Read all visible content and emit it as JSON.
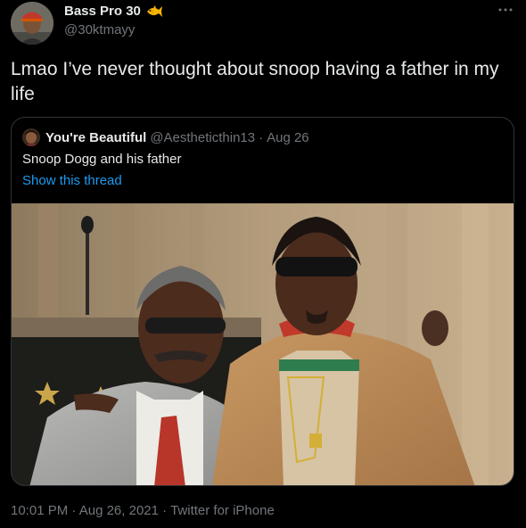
{
  "tweet": {
    "author_name": "Bass Pro 30",
    "author_handle": "@30ktmayy",
    "text": "Lmao I’ve never thought about snoop having a father in my life",
    "time": "10:01 PM",
    "date": "Aug 26, 2021",
    "source": "Twitter for iPhone",
    "separator": "·"
  },
  "quoted_tweet": {
    "author_name": "You're Beautiful",
    "author_handle": "@Aestheticthin13",
    "date": "Aug 26",
    "separator": "·",
    "text": "Snoop Dogg and his father",
    "show_thread_label": "Show this thread"
  },
  "icons": {
    "author_badge": "fish-emoji-icon",
    "more": "more-dots-icon"
  },
  "colors": {
    "background": "#000000",
    "text_primary": "#e7e9ea",
    "text_secondary": "#71767b",
    "link": "#1d9bf0",
    "border": "#2f3336"
  }
}
